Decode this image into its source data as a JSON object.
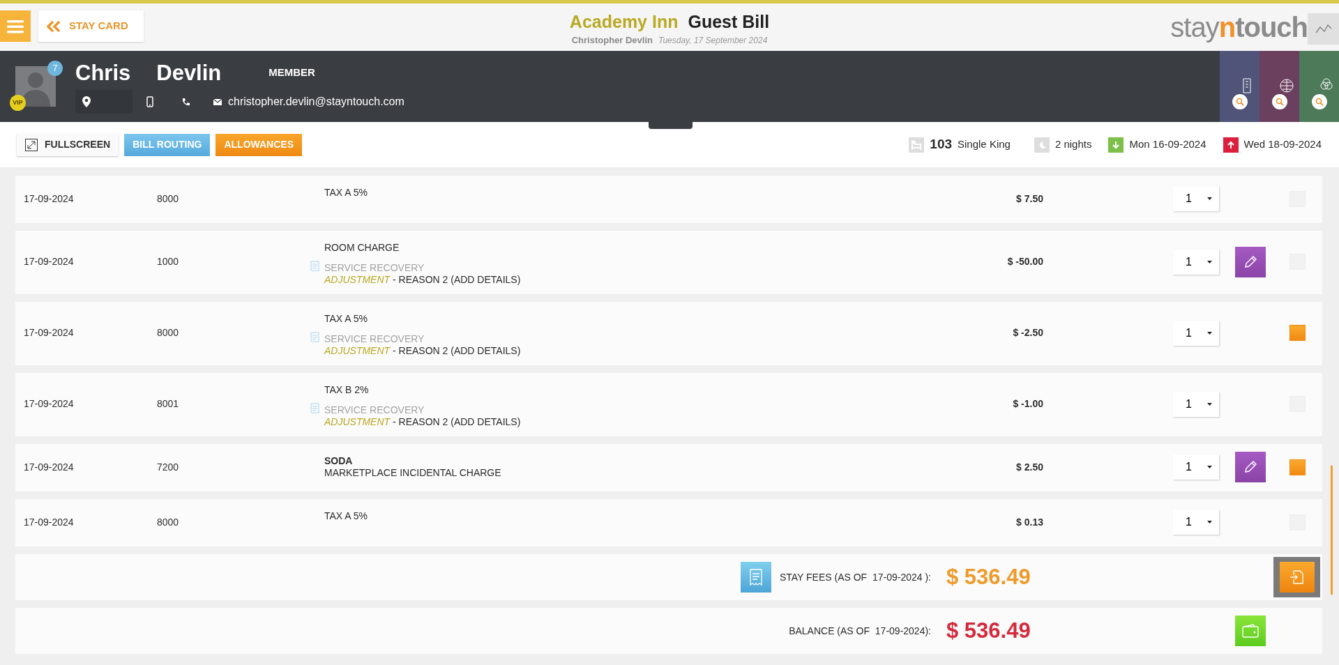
{
  "header": {
    "back_button": "STAY CARD",
    "hotel": "Academy Inn",
    "title": "Guest Bill",
    "guest_name": "Christopher Devlin",
    "date": "Tuesday, 17 September 2024",
    "logo": {
      "before": "stay",
      "accent": "n",
      "after": "touch"
    }
  },
  "guest": {
    "first_name": "Chris",
    "last_name": "Devlin",
    "membership": "MEMBER",
    "notifications": "7",
    "vip": "VIP",
    "email": "christopher.devlin@stayntouch.com"
  },
  "toolbar": {
    "buttons": [
      {
        "label": "FULLSCREEN",
        "kind": "fullscreen"
      },
      {
        "label": "BILL ROUTING",
        "kind": "info"
      },
      {
        "label": "ALLOWANCES",
        "kind": "warning"
      }
    ]
  },
  "stay": {
    "room": "103",
    "room_type": "Single King",
    "nights": "2 nights",
    "arrival": "Mon 16-09-2024",
    "departure": "Wed 18-09-2024"
  },
  "charges": [
    {
      "date": "17-09-2024",
      "code": "8000",
      "title": "TAX A 5%",
      "bold": false,
      "note": false,
      "amount": "$ 7.50",
      "quantity": "1",
      "editable": false,
      "selected": false
    },
    {
      "date": "17-09-2024",
      "code": "1000",
      "title": "ROOM CHARGE",
      "bold": false,
      "note": true,
      "lines": [
        {
          "kind": "muted",
          "text": "SERVICE RECOVERY"
        },
        {
          "kind": "reason",
          "text": "*ADJUSTMENT* - REASON 2 (ADD DETAILS)"
        }
      ],
      "amount": "$ -50.00",
      "quantity": "1",
      "editable": true,
      "selected": false
    },
    {
      "date": "17-09-2024",
      "code": "8000",
      "title": "TAX A 5%",
      "bold": false,
      "note": true,
      "lines": [
        {
          "kind": "muted",
          "text": "SERVICE RECOVERY"
        },
        {
          "kind": "reason",
          "text": "*ADJUSTMENT* - REASON 2 (ADD DETAILS)"
        }
      ],
      "amount": "$ -2.50",
      "quantity": "1",
      "editable": false,
      "selected": true
    },
    {
      "date": "17-09-2024",
      "code": "8001",
      "title": "TAX B 2%",
      "bold": false,
      "note": true,
      "lines": [
        {
          "kind": "muted",
          "text": "SERVICE RECOVERY"
        },
        {
          "kind": "reason",
          "text": "*ADJUSTMENT* - REASON 2 (ADD DETAILS)"
        }
      ],
      "amount": "$ -1.00",
      "quantity": "1",
      "editable": false,
      "selected": false
    },
    {
      "date": "17-09-2024",
      "code": "7200",
      "title": "SODA",
      "bold": true,
      "note": false,
      "lines": [
        {
          "kind": "plain",
          "text": "MARKETPLACE INCIDENTAL CHARGE"
        }
      ],
      "amount": "$ 2.50",
      "quantity": "1",
      "editable": true,
      "selected": true
    },
    {
      "date": "17-09-2024",
      "code": "8000",
      "title": "TAX A 5%",
      "bold": false,
      "note": false,
      "amount": "$ 0.13",
      "quantity": "1",
      "editable": false,
      "selected": false
    }
  ],
  "totals": {
    "stay_fees": {
      "label": "STAY FEES (AS OF  17-09-2024 ):",
      "amount": "$ 536.49"
    },
    "balance": {
      "label": "BALANCE (AS OF  17-09-2024):",
      "amount": "$ 536.49"
    }
  }
}
